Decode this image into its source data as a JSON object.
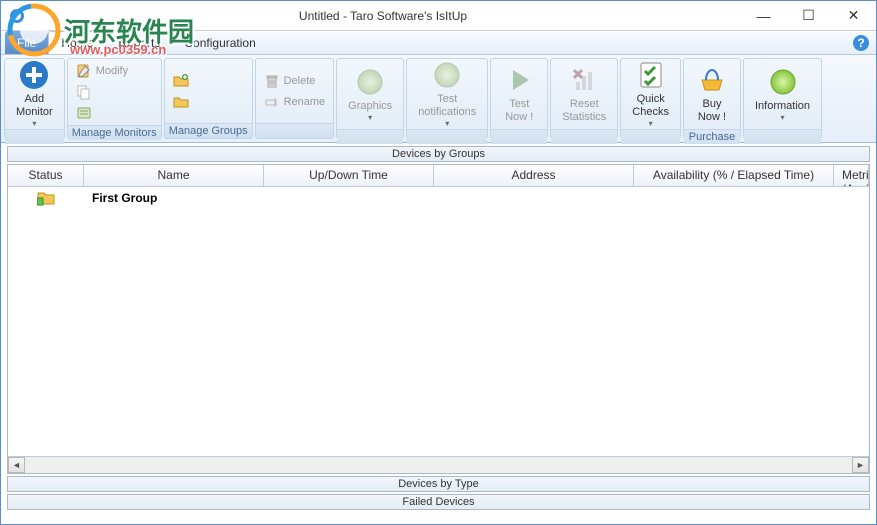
{
  "window": {
    "title": "Untitled - Taro Software's IsItUp"
  },
  "watermark": {
    "text": "河东软件园",
    "url": "www.pc0359.cn"
  },
  "menubar": {
    "file": "File",
    "home": "Home",
    "reports": "Reports",
    "configuration": "Configuration"
  },
  "ribbon": {
    "add_monitor": "Add\nMonitor",
    "manage_monitors_group": "Manage Monitors",
    "modify": "Modify",
    "copy": "",
    "property": "",
    "manage_groups_group": "Manage Groups",
    "new_group": "",
    "delete": "Delete",
    "rename": "Rename",
    "graphics": "Graphics",
    "test_notifications": "Test\nnotifications",
    "test_now": "Test\nNow !",
    "reset_statistics": "Reset\nStatistics",
    "quick_checks": "Quick\nChecks",
    "buy_now": "Buy\nNow !",
    "purchase_group": "Purchase",
    "information": "Information"
  },
  "panels": {
    "devices_by_groups": "Devices by Groups",
    "devices_by_type": "Devices by Type",
    "failed_devices": "Failed Devices"
  },
  "grid": {
    "columns": {
      "status": "Status",
      "name": "Name",
      "updown": "Up/Down Time",
      "address": "Address",
      "availability": "Availability (% / Elapsed Time)",
      "metric": "Metric (Avg)"
    },
    "rows": [
      {
        "name": "First Group"
      }
    ]
  }
}
